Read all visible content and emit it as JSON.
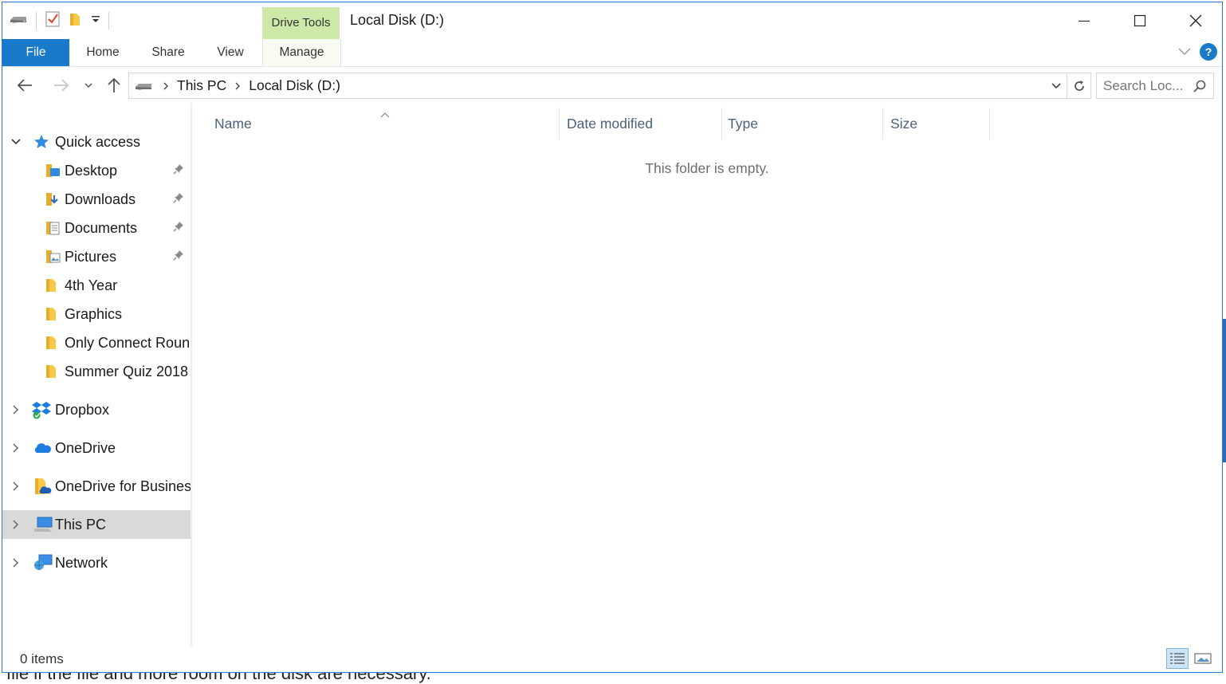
{
  "window": {
    "title": "Local Disk (D:)",
    "context_tab_group": "Drive Tools"
  },
  "ribbon": {
    "tabs": [
      {
        "label": "File"
      },
      {
        "label": "Home"
      },
      {
        "label": "Share"
      },
      {
        "label": "View"
      },
      {
        "label": "Manage"
      }
    ],
    "help_label": "?"
  },
  "address": {
    "crumbs": [
      "This PC",
      "Local Disk (D:)"
    ]
  },
  "search": {
    "placeholder": "Search Loc..."
  },
  "nav_pane": {
    "quick_access": {
      "label": "Quick access",
      "items": [
        {
          "label": "Desktop",
          "pinned": true,
          "icon": "desktop-folder-icon"
        },
        {
          "label": "Downloads",
          "pinned": true,
          "icon": "downloads-folder-icon"
        },
        {
          "label": "Documents",
          "pinned": true,
          "icon": "documents-folder-icon"
        },
        {
          "label": "Pictures",
          "pinned": true,
          "icon": "pictures-folder-icon"
        },
        {
          "label": "4th Year",
          "pinned": false,
          "icon": "folder-icon"
        },
        {
          "label": "Graphics",
          "pinned": false,
          "icon": "folder-icon"
        },
        {
          "label": "Only Connect Round",
          "pinned": false,
          "icon": "folder-icon"
        },
        {
          "label": "Summer Quiz 2018",
          "pinned": false,
          "icon": "folder-icon"
        }
      ]
    },
    "roots": [
      {
        "label": "Dropbox",
        "icon": "dropbox-icon",
        "selected": false
      },
      {
        "label": "OneDrive",
        "icon": "onedrive-cloud-icon",
        "selected": false
      },
      {
        "label": "OneDrive for Business",
        "icon": "onedrive-business-icon",
        "selected": false
      },
      {
        "label": "This PC",
        "icon": "computer-icon",
        "selected": true
      },
      {
        "label": "Network",
        "icon": "network-icon",
        "selected": false
      }
    ]
  },
  "columns": [
    {
      "label": "Name"
    },
    {
      "label": "Date modified"
    },
    {
      "label": "Type"
    },
    {
      "label": "Size"
    }
  ],
  "content": {
    "empty_message": "This folder is empty."
  },
  "status": {
    "item_count": "0 items"
  },
  "background_text": "file if the file and more room on the disk are necessary.",
  "colors": {
    "file_tab": "#1979ca",
    "drive_tools": "#cde9a8",
    "selected_nav": "#d9d9d9",
    "column_header_text": "#4c607a"
  }
}
